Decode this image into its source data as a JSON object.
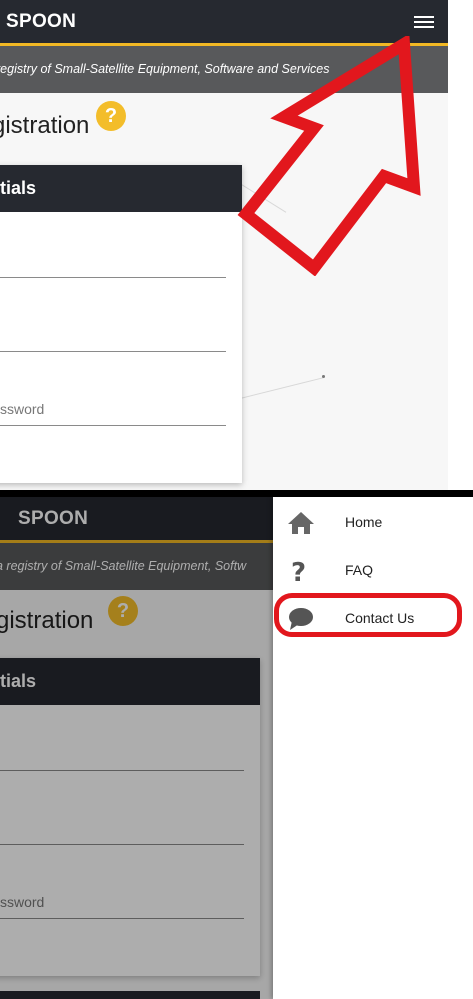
{
  "header": {
    "brand": "SPOON",
    "menu_icon": "hamburger-menu-icon",
    "accent": "#f2b824",
    "bg": "#262930"
  },
  "tagline": {
    "top": "registry of Small-Satellite Equipment, Software and Services",
    "bottom": "a registry of Small-Satellite Equipment, Softw"
  },
  "page": {
    "title_top": "gistration",
    "title_bottom": "gistration",
    "help_icon_glyph": "?"
  },
  "credentials_card": {
    "header_top": "tials",
    "header_bottom": "tials",
    "password_placeholder": "ssword"
  },
  "annotation": {
    "arrow_color": "#e2171d",
    "highlight_color": "#e2171d"
  },
  "drawer": {
    "items": [
      {
        "label": "Home",
        "icon": "home-icon"
      },
      {
        "label": "FAQ",
        "icon": "question-mark-icon"
      },
      {
        "label": "Contact Us",
        "icon": "speech-bubble-icon"
      }
    ]
  }
}
